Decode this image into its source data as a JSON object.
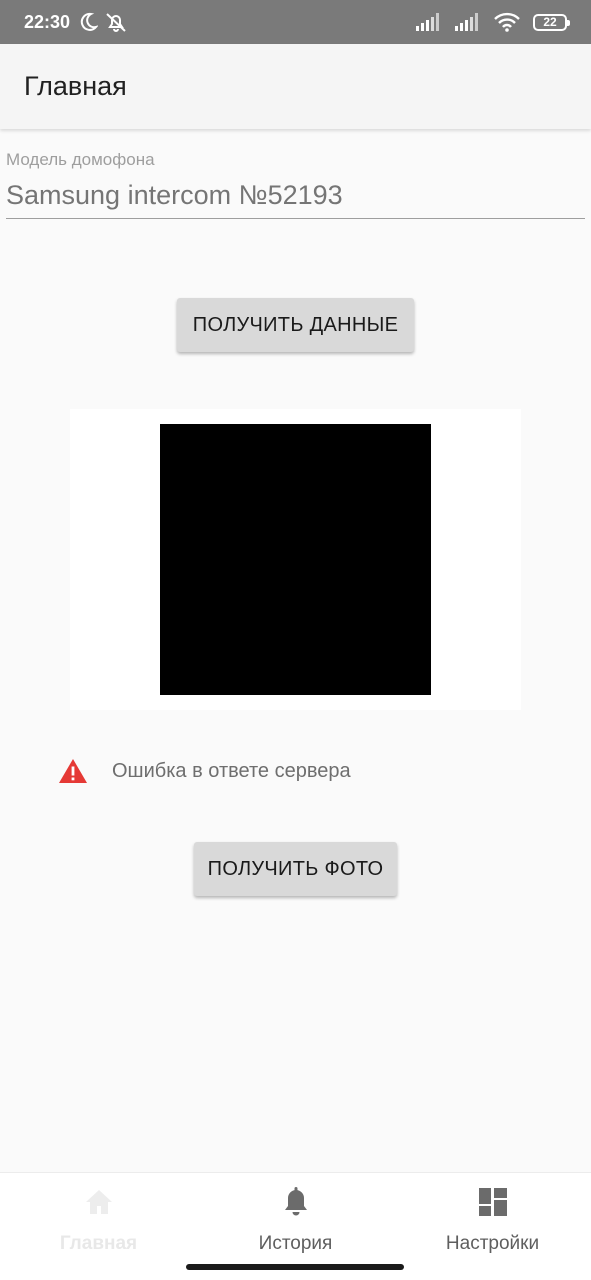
{
  "status_bar": {
    "time": "22:30",
    "battery": "22",
    "icons": [
      "moon-icon",
      "alarm-off-icon",
      "signal-icon",
      "signal-icon",
      "wifi-icon",
      "battery-icon"
    ]
  },
  "app_bar": {
    "title": "Главная"
  },
  "intercom_field": {
    "label": "Модель домофона",
    "placeholder": "Samsung intercom №52193",
    "value": ""
  },
  "buttons": {
    "get_data": "ПОЛУЧИТЬ ДАННЫЕ",
    "get_photo": "ПОЛУЧИТЬ ФОТО"
  },
  "error": {
    "message": "Ошибка в ответе сервера",
    "color": "#e53935"
  },
  "bottom_nav": {
    "items": [
      {
        "label": "Главная",
        "icon": "home-icon",
        "active": true
      },
      {
        "label": "История",
        "icon": "bell-icon",
        "active": false
      },
      {
        "label": "Настройки",
        "icon": "dashboard-icon",
        "active": false
      }
    ]
  }
}
